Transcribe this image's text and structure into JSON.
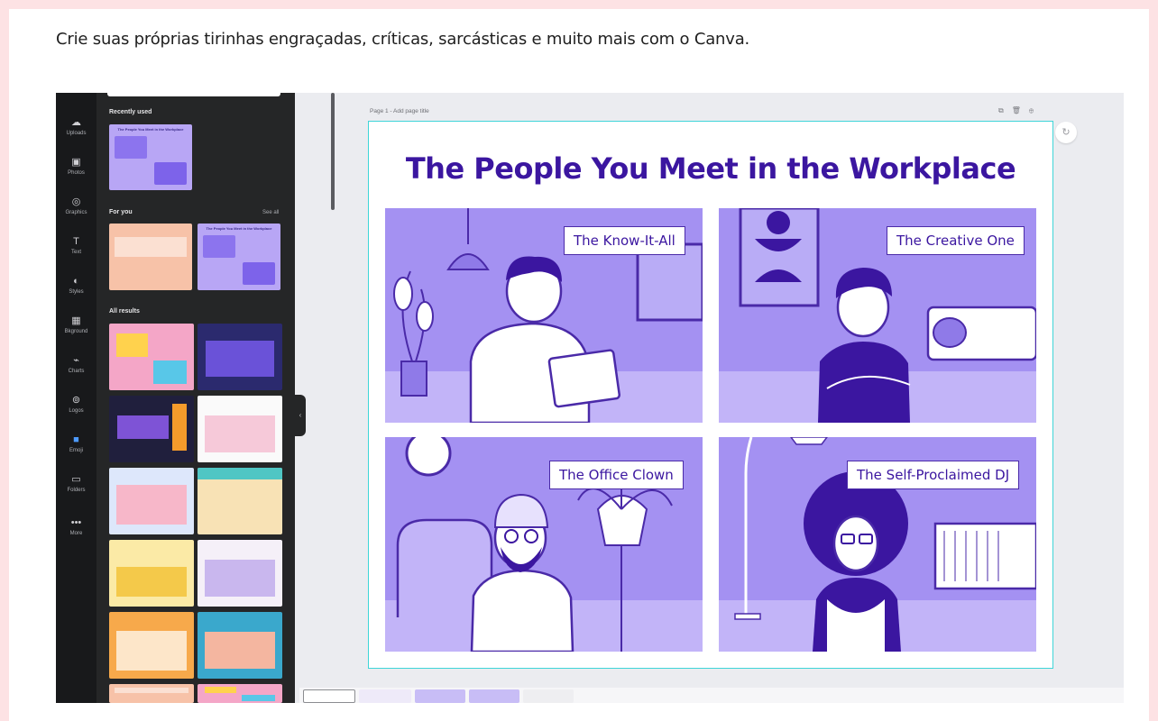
{
  "caption": "Crie suas próprias tirinhas engraçadas, críticas, sarcásticas e muito mais com o Canva.",
  "sidebar": {
    "items": [
      {
        "label": "Uploads",
        "icon": "upload-icon"
      },
      {
        "label": "Photos",
        "icon": "photos-icon"
      },
      {
        "label": "Graphics",
        "icon": "graphics-icon"
      },
      {
        "label": "Text",
        "icon": "text-icon"
      },
      {
        "label": "Styles",
        "icon": "styles-icon"
      },
      {
        "label": "Bkground",
        "icon": "background-icon"
      },
      {
        "label": "Charts",
        "icon": "charts-icon"
      },
      {
        "label": "Logos",
        "icon": "logos-icon"
      },
      {
        "label": "Emoji",
        "icon": "emoji-icon"
      },
      {
        "label": "Folders",
        "icon": "folder-icon"
      },
      {
        "label": "More",
        "icon": "more-icon"
      }
    ]
  },
  "panel": {
    "recently_used": "Recently used",
    "for_you": "For you",
    "see_all": "See all",
    "all_results": "All results",
    "recent_thumb_title": "The People You Meet in the Workplace",
    "for_you_thumb_title": "The People You Meet in the Workplace"
  },
  "canvas": {
    "page_label": "Page 1 - Add page title",
    "page_icons": [
      "copy-icon",
      "trash-icon",
      "add-page-icon"
    ],
    "design_title": "The People You Meet in the Workplace",
    "panels": [
      {
        "label": "The Know-It-All"
      },
      {
        "label": "The Creative One"
      },
      {
        "label": "The Office Clown"
      },
      {
        "label": "The Self-Proclaimed DJ"
      }
    ]
  },
  "colors": {
    "background": "#fde2e4",
    "accent_purple": "#3b16a0",
    "panel_lavender": "#a491f2",
    "selection": "#3fd5d8",
    "sidebar_dark": "#18191b"
  }
}
